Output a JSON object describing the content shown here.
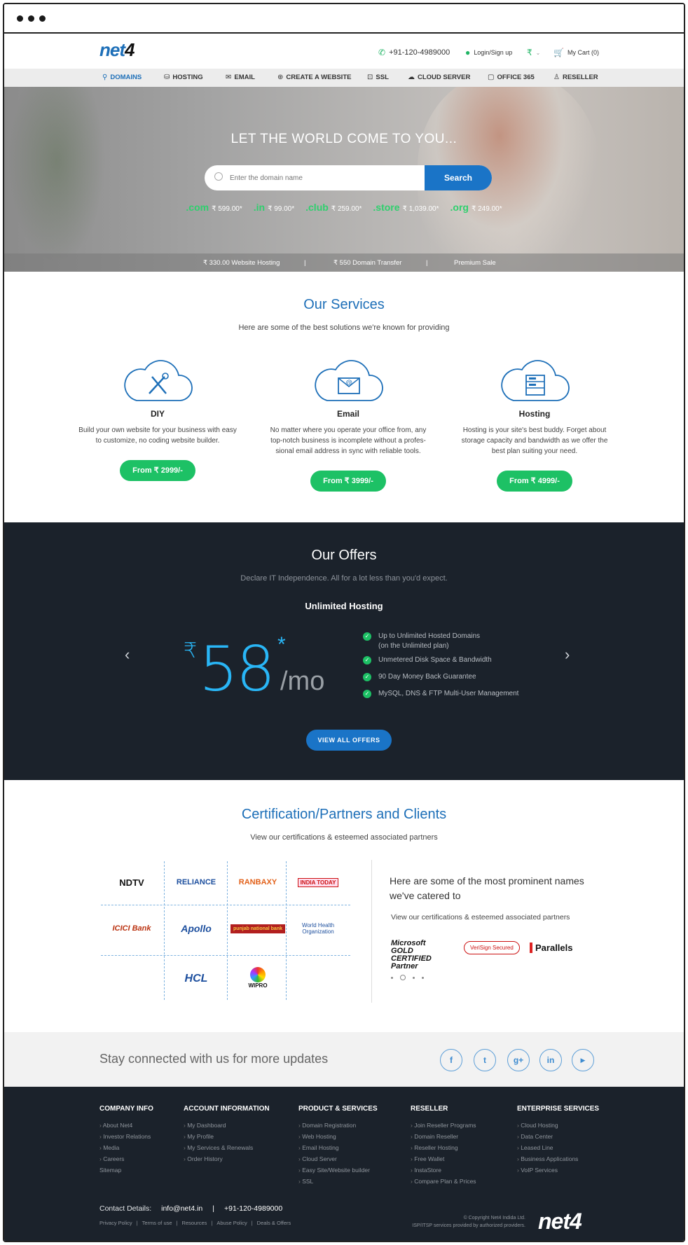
{
  "header": {
    "logo_text": "net",
    "logo_suffix": "4",
    "phone": "+91-120-4989000",
    "login": "Login/Sign up",
    "currency": "₹",
    "cart": "My Cart (0)"
  },
  "nav": [
    {
      "label": "DOMAINS",
      "icon": "link-icon"
    },
    {
      "label": "HOSTING",
      "icon": "database-icon"
    },
    {
      "label": "EMAIL",
      "icon": "mail-icon"
    },
    {
      "label": "CREATE A WEBSITE",
      "icon": "globe-icon"
    },
    {
      "label": "SSL",
      "icon": "lock-icon"
    },
    {
      "label": "CLOUD SERVER",
      "icon": "cloud-icon"
    },
    {
      "label": "OFFICE 365",
      "icon": "window-icon"
    },
    {
      "label": "RESELLER",
      "icon": "user-icon"
    }
  ],
  "hero": {
    "title": "LET THE WORLD COME TO YOU...",
    "search_placeholder": "Enter the domain name",
    "search_button": "Search",
    "tlds": [
      {
        "name": ".com",
        "price": "₹ 599.00*"
      },
      {
        "name": ".in",
        "price": "₹ 99.00*"
      },
      {
        "name": ".club",
        "price": "₹ 259.00*"
      },
      {
        "name": ".store",
        "price": "₹ 1,039.00*"
      },
      {
        "name": ".org",
        "price": "₹ 249.00*"
      }
    ],
    "promos": [
      "₹ 330.00 Website Hosting",
      "|",
      "₹ 550 Domain Transfer",
      "|",
      "Premium Sale"
    ]
  },
  "services": {
    "title": "Our Services",
    "subtitle": "Here are some of the best solutions we're known for providing",
    "items": [
      {
        "title": "DIY",
        "desc": "Build your own website for your business with easy to customize, no coding website builder.",
        "price": "From ₹ 2999/-",
        "icon": "tools-icon"
      },
      {
        "title": "Email",
        "desc": "No matter where you operate your office from, any top-notch business is incomplete without a profes- sional email address in sync with reliable tools.",
        "price": "From ₹ 3999/-",
        "icon": "email-icon"
      },
      {
        "title": "Hosting",
        "desc": "Hosting is your site's best buddy. Forget about storage capacity and bandwidth as we offer the best plan suiting your need.",
        "price": "From ₹ 4999/-",
        "icon": "server-icon"
      }
    ]
  },
  "offers": {
    "title": "Our Offers",
    "subtitle": "Declare IT Independence. All for a lot less than you'd expect.",
    "plan": "Unlimited Hosting",
    "currency": "₹",
    "price": "58",
    "star": "*",
    "per": "/mo",
    "features": [
      {
        "line1": "Up to Unlimited Hosted Domains",
        "line2": "(on the Unlimited plan)"
      },
      {
        "line1": "Unmetered Disk Space & Bandwidth",
        "line2": ""
      },
      {
        "line1": "90 Day Money Back Guarantee",
        "line2": ""
      },
      {
        "line1": "MySQL, DNS & FTP Multi-User Management",
        "line2": ""
      }
    ],
    "button": "VIEW ALL OFFERS",
    "prev": "‹",
    "next": "›"
  },
  "partners": {
    "title": "Certification/Partners and Clients",
    "subtitle": "View our certifications & esteemed associated partners",
    "clients": [
      "NDTV",
      "RELIANCE",
      "RANBAXY",
      "INDIA TODAY",
      "ICICI Bank",
      "Apollo",
      "punjab national bank",
      "World Health Organization",
      "HCL",
      "WIPRO"
    ],
    "right_title": "Here are some of the most prominent names we've catered to",
    "right_sub": "View our certifications & esteemed associated partners",
    "certs": [
      "Microsoft GOLD CERTIFIED Partner",
      "VeriSign Secured",
      "Parallels"
    ]
  },
  "stay": {
    "text": "Stay connected with us for more updates",
    "socials": [
      "f",
      "t",
      "g+",
      "in",
      "▶"
    ]
  },
  "footer": {
    "columns": [
      {
        "title": "COMPANY INFO",
        "links": [
          "About Net4",
          "Investor Relations",
          "Media",
          "Careers",
          "Sitemap"
        ]
      },
      {
        "title": "ACCOUNT INFORMATION",
        "links": [
          "My Dashboard",
          "My Profile",
          "My Services & Renewals",
          "Order History"
        ]
      },
      {
        "title": "PRODUCT & SERVICES",
        "links": [
          "Domain Registration",
          "Web Hosting",
          "Email Hosting",
          "Cloud Server",
          "Easy Site/Website builder",
          "SSL"
        ]
      },
      {
        "title": "RESELLER",
        "links": [
          "Join Reseller Programs",
          "Domain Reseller",
          "Reseller Hosting",
          "Free Wallet",
          "InstaStore",
          "Compare Plan & Prices"
        ]
      },
      {
        "title": "ENTERPRISE SERVICES",
        "links": [
          "Cloud Hosting",
          "Data Center",
          "Leased Line",
          "Business Applications",
          "VoIP Services"
        ]
      }
    ],
    "contact_label": "Contact Details:",
    "email": "info@net4.in",
    "sep": "|",
    "phone": "+91-120-4989000",
    "bottom_links": [
      "Privacy Policy",
      "|",
      "Terms of use",
      "|",
      "Resources",
      "|",
      "Abuse Policy",
      "|",
      "Deals & Offers"
    ],
    "copyright": "© Copyright Net4 Indida Ltd.",
    "copyright2": "ISP/ITSP services provided by authorized providers.",
    "logo": "net4"
  },
  "colors": {
    "accent": "#1a74c7",
    "green": "#1dc165",
    "dark": "#1b222b"
  }
}
